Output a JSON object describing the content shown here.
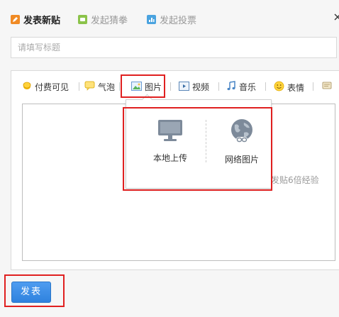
{
  "tabs": [
    {
      "label": "发表新贴",
      "icon": "pencil-icon",
      "color": "#f08a24"
    },
    {
      "label": "发起猜拳",
      "icon": "fist-icon",
      "color": "#8bc34a"
    },
    {
      "label": "发起投票",
      "icon": "bar-chart-icon",
      "color": "#4aa3df"
    }
  ],
  "title_input": {
    "placeholder": "请填写标题"
  },
  "toolbar": {
    "items": [
      {
        "label": "付费可见",
        "icon": "coin-icon"
      },
      {
        "label": "气泡",
        "icon": "speech-bubble-icon"
      },
      {
        "label": "图片",
        "icon": "image-icon"
      },
      {
        "label": "视频",
        "icon": "video-icon"
      },
      {
        "label": "音乐",
        "icon": "music-icon"
      },
      {
        "label": "表情",
        "icon": "smiley-icon"
      }
    ]
  },
  "image_dropdown": {
    "local_label": "本地上传",
    "web_label": "网络图片"
  },
  "hint_text": "开通超级会员发贴6倍经验",
  "submit_label": "发表",
  "colors": {
    "accent": "#3a8ee6",
    "highlight": "#e02020"
  }
}
